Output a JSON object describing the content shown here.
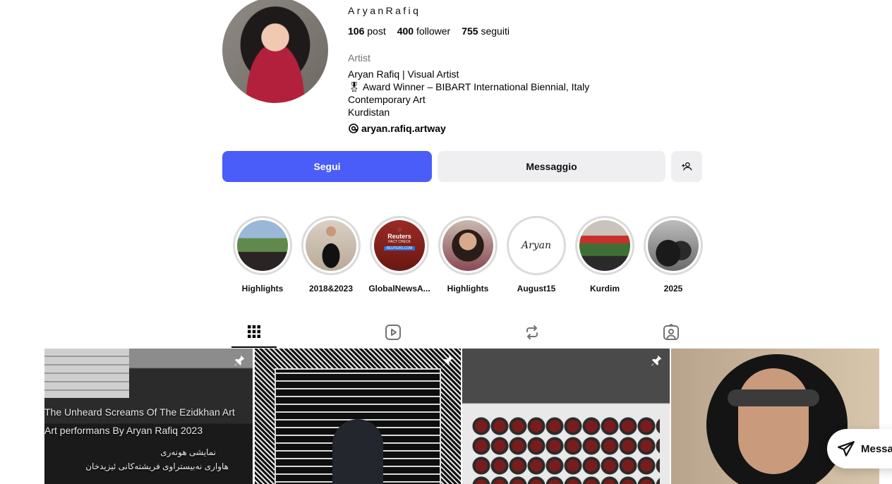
{
  "profile": {
    "username": "AryanRafiq",
    "stats": {
      "posts": "106",
      "posts_label": "post",
      "followers": "400",
      "followers_label": "follower",
      "following": "755",
      "following_label": "seguiti"
    },
    "category": "Artist",
    "bio": [
      "Aryan Rafiq | Visual Artist",
      "🎖 Award Winner – BIBART International Biennial, Italy",
      "Contemporary Art",
      "Kurdistan"
    ],
    "link": "aryan.rafiq.artway"
  },
  "actions": {
    "follow_label": "Segui",
    "message_label": "Messaggio",
    "add_user_icon": "person-add-icon"
  },
  "highlights": [
    {
      "label": "Highlights"
    },
    {
      "label": "2018&2023"
    },
    {
      "label": "GlobalNewsA...",
      "thumb_title": "Reuters",
      "thumb_sub": "FACT CHECK",
      "thumb_badge": "REUTERS.COM"
    },
    {
      "label": "Highlights"
    },
    {
      "label": "August15",
      "thumb_text": "Aryan"
    },
    {
      "label": "Kurdim"
    },
    {
      "label": "2025"
    }
  ],
  "tabs": [
    {
      "name": "posts",
      "icon": "grid-icon",
      "active": true
    },
    {
      "name": "reels",
      "icon": "reels-icon",
      "active": false
    },
    {
      "name": "reposts",
      "icon": "repost-icon",
      "active": false
    },
    {
      "name": "tagged",
      "icon": "tagged-icon",
      "active": false
    }
  ],
  "posts": [
    {
      "pinned": true,
      "lines": [
        "The Unheard Screams Of The Ezidkhan  Art",
        "Art performans  By Aryan Rafiq     2023",
        "نمایشی هونەری",
        "هاواری نەبیستراوی فریشتەکانی ئیزیدخان"
      ]
    },
    {
      "pinned": true
    },
    {
      "pinned": true
    },
    {
      "pinned": false
    }
  ],
  "floating": {
    "label": "Messaggi",
    "icon": "direct-message-icon"
  },
  "colors": {
    "accent": "#4a5df9",
    "secondary_button": "#efeff2",
    "muted_text": "#737373"
  }
}
